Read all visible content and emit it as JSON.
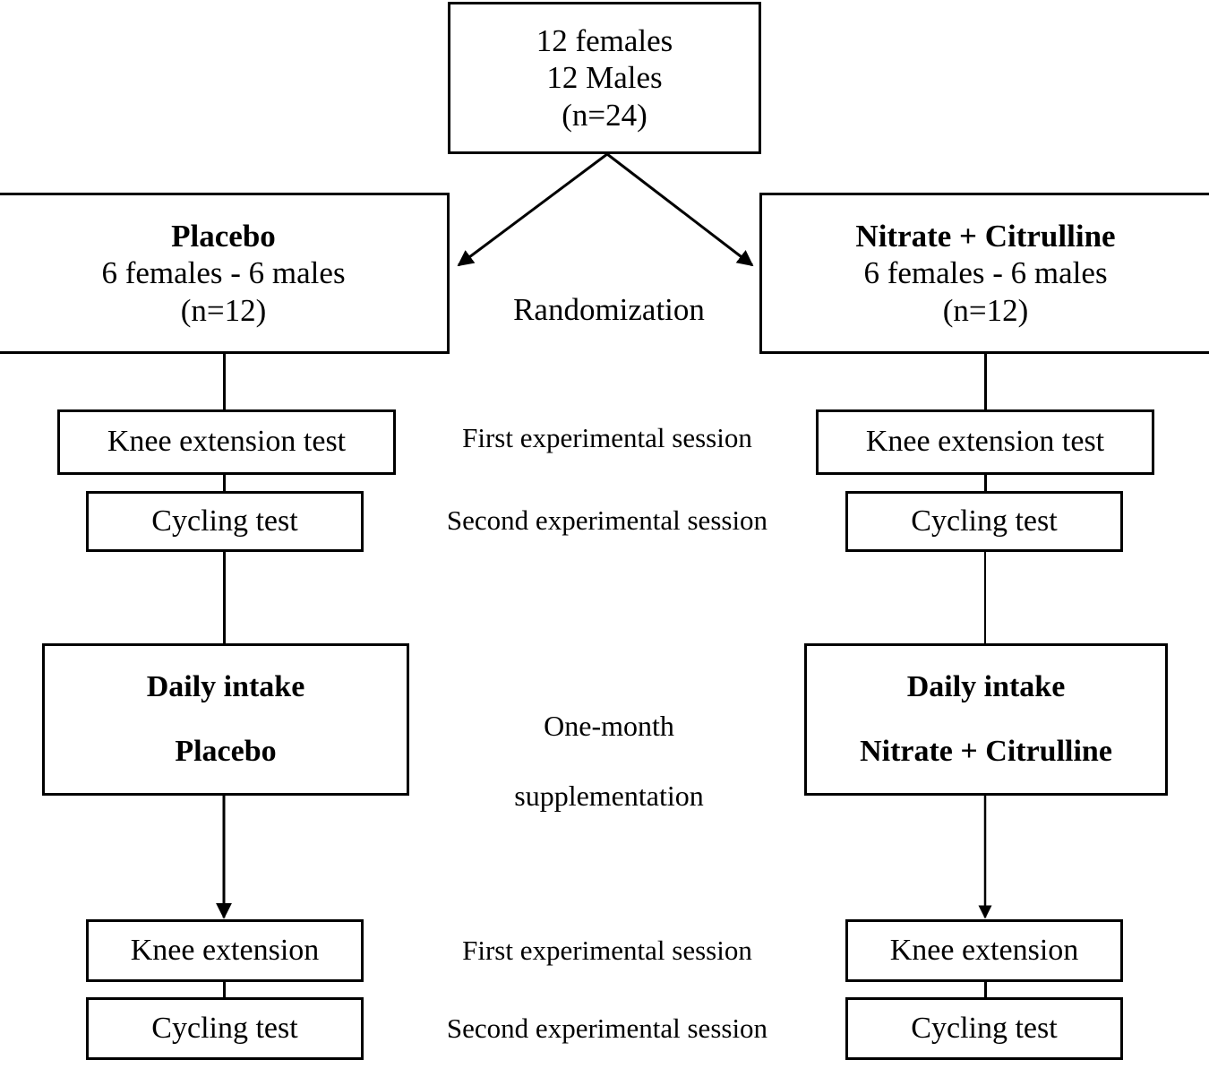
{
  "diagram": {
    "title": "Study design flowchart",
    "colors": {
      "line": "#000000",
      "box_fill": "#ffffff",
      "text": "#000000"
    },
    "top_box": {
      "line1": "12 females",
      "line2": "12 Males",
      "line3": "(n=24)"
    },
    "randomization_label": "Randomization",
    "groups": {
      "placebo": {
        "title": "Placebo",
        "line2": "6 females - 6 males",
        "line3": "(n=12)",
        "pre_test_1": "Knee extension test",
        "pre_test_2": "Cycling test",
        "intake_title": "Daily intake",
        "intake_substance": "Placebo",
        "post_test_1": "Knee extension",
        "post_test_2": "Cycling test"
      },
      "nitrate_citrulline": {
        "title": "Nitrate + Citrulline",
        "line2": "6 females - 6 males",
        "line3": "(n=12)",
        "pre_test_1": "Knee extension test",
        "pre_test_2": "Cycling test",
        "intake_title": "Daily intake",
        "intake_substance": "Nitrate + Citrulline",
        "post_test_1": "Knee extension",
        "post_test_2": "Cycling test"
      }
    },
    "middle_labels": {
      "first_session_top": "First experimental session",
      "second_session_top": "Second experimental session",
      "supplementation_line1": "One-month",
      "supplementation_line2": "supplementation",
      "first_session_bottom": "First experimental session",
      "second_session_bottom": "Second experimental session"
    }
  }
}
